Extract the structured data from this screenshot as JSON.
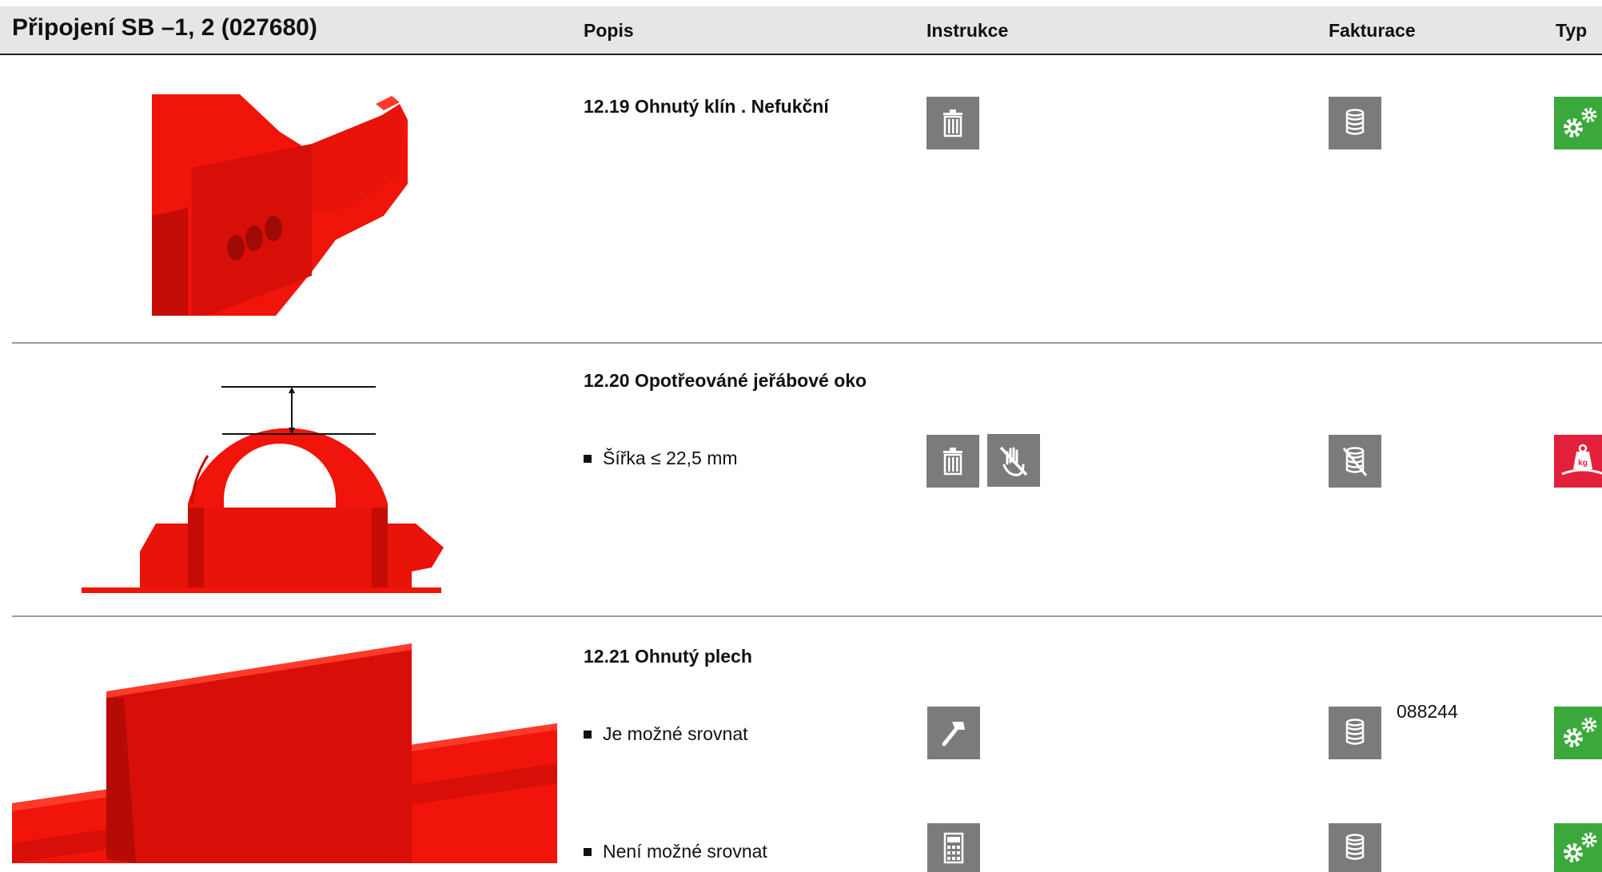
{
  "header": {
    "title": "Připojení SB –1, 2 (027680)",
    "col_popis": "Popis",
    "col_instrukce": "Instrukce",
    "col_fakturace": "Fakturace",
    "col_typ": "Typ"
  },
  "colors": {
    "part_red": "#f0140a",
    "icon_gray": "#7b7b7b",
    "typ_green": "#3aa83a",
    "typ_red": "#e3203a"
  },
  "rows": [
    {
      "title": "12.19 Ohnutý klín . Nefukční",
      "instrukce_icons": [
        "trash-icon"
      ],
      "fakturace_icon": "coin-stack-icon",
      "typ_icon": "gears-icon"
    },
    {
      "title": "12.20 Opotřeováné jeřábové oko",
      "bullet": "Šířka ≤ 22,5 mm",
      "instrukce_icons": [
        "trash-icon",
        "no-hand-icon"
      ],
      "fakturace_icon": "coin-stack-crossed-icon",
      "typ_icon": "weight-kg-icon"
    },
    {
      "title": "12.21 Ohnutý plech",
      "bullets": [
        {
          "text": "Je možné srovnat",
          "instrukce_icon": "hammer-icon",
          "fakturace_icon": "coin-stack-icon",
          "part_number": "088244",
          "typ_icon": "gears-icon"
        },
        {
          "text": "Není možné srovnat",
          "instrukce_icon": "calculator-icon",
          "fakturace_icon": "coin-stack-icon",
          "typ_icon": "gears-icon"
        }
      ]
    }
  ]
}
